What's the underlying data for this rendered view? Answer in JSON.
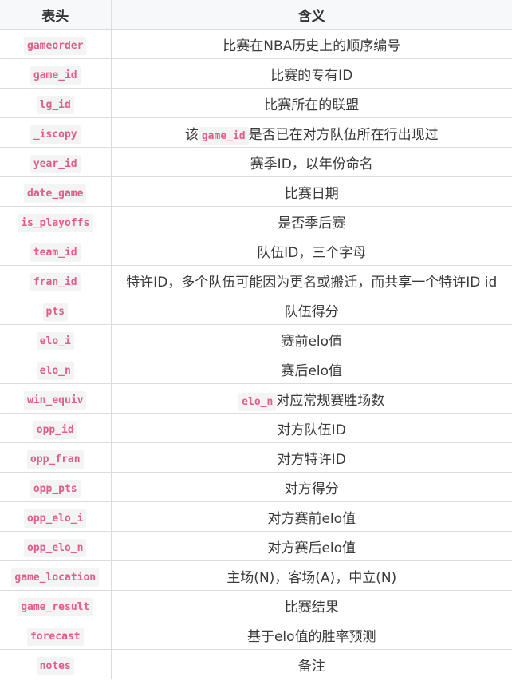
{
  "table": {
    "headers": [
      "表头",
      "含义"
    ],
    "rows": [
      {
        "field": "gameorder",
        "desc_pre": "比赛在NBA历史上的顺序编号",
        "desc_code": "",
        "desc_post": ""
      },
      {
        "field": "game_id",
        "desc_pre": "比赛的专有ID",
        "desc_code": "",
        "desc_post": ""
      },
      {
        "field": "lg_id",
        "desc_pre": "比赛所在的联盟",
        "desc_code": "",
        "desc_post": ""
      },
      {
        "field": "_iscopy",
        "desc_pre": "该",
        "desc_code": "game_id",
        "desc_post": "是否已在对方队伍所在行出现过"
      },
      {
        "field": "year_id",
        "desc_pre": "赛季ID，以年份命名",
        "desc_code": "",
        "desc_post": ""
      },
      {
        "field": "date_game",
        "desc_pre": "比赛日期",
        "desc_code": "",
        "desc_post": ""
      },
      {
        "field": "is_playoffs",
        "desc_pre": "是否季后赛",
        "desc_code": "",
        "desc_post": ""
      },
      {
        "field": "team_id",
        "desc_pre": "队伍ID，三个字母",
        "desc_code": "",
        "desc_post": ""
      },
      {
        "field": "fran_id",
        "desc_pre": "特许ID，多个队伍可能因为更名或搬迁，而共享一个特许ID id",
        "desc_code": "",
        "desc_post": ""
      },
      {
        "field": "pts",
        "desc_pre": "队伍得分",
        "desc_code": "",
        "desc_post": ""
      },
      {
        "field": "elo_i",
        "desc_pre": "赛前elo值",
        "desc_code": "",
        "desc_post": ""
      },
      {
        "field": "elo_n",
        "desc_pre": "赛后elo值",
        "desc_code": "",
        "desc_post": ""
      },
      {
        "field": "win_equiv",
        "desc_pre": "",
        "desc_code": "elo_n",
        "desc_post": "对应常规赛胜场数"
      },
      {
        "field": "opp_id",
        "desc_pre": "对方队伍ID",
        "desc_code": "",
        "desc_post": ""
      },
      {
        "field": "opp_fran",
        "desc_pre": "对方特许ID",
        "desc_code": "",
        "desc_post": ""
      },
      {
        "field": "opp_pts",
        "desc_pre": "对方得分",
        "desc_code": "",
        "desc_post": ""
      },
      {
        "field": "opp_elo_i",
        "desc_pre": "对方赛前elo值",
        "desc_code": "",
        "desc_post": ""
      },
      {
        "field": "opp_elo_n",
        "desc_pre": "对方赛后elo值",
        "desc_code": "",
        "desc_post": ""
      },
      {
        "field": "game_location",
        "desc_pre": "主场(N)，客场(A)，中立(N)",
        "desc_code": "",
        "desc_post": ""
      },
      {
        "field": "game_result",
        "desc_pre": "比赛结果",
        "desc_code": "",
        "desc_post": ""
      },
      {
        "field": "forecast",
        "desc_pre": "基于elo值的胜率预测",
        "desc_code": "",
        "desc_post": ""
      },
      {
        "field": "notes",
        "desc_pre": "备注",
        "desc_code": "",
        "desc_post": ""
      }
    ]
  }
}
